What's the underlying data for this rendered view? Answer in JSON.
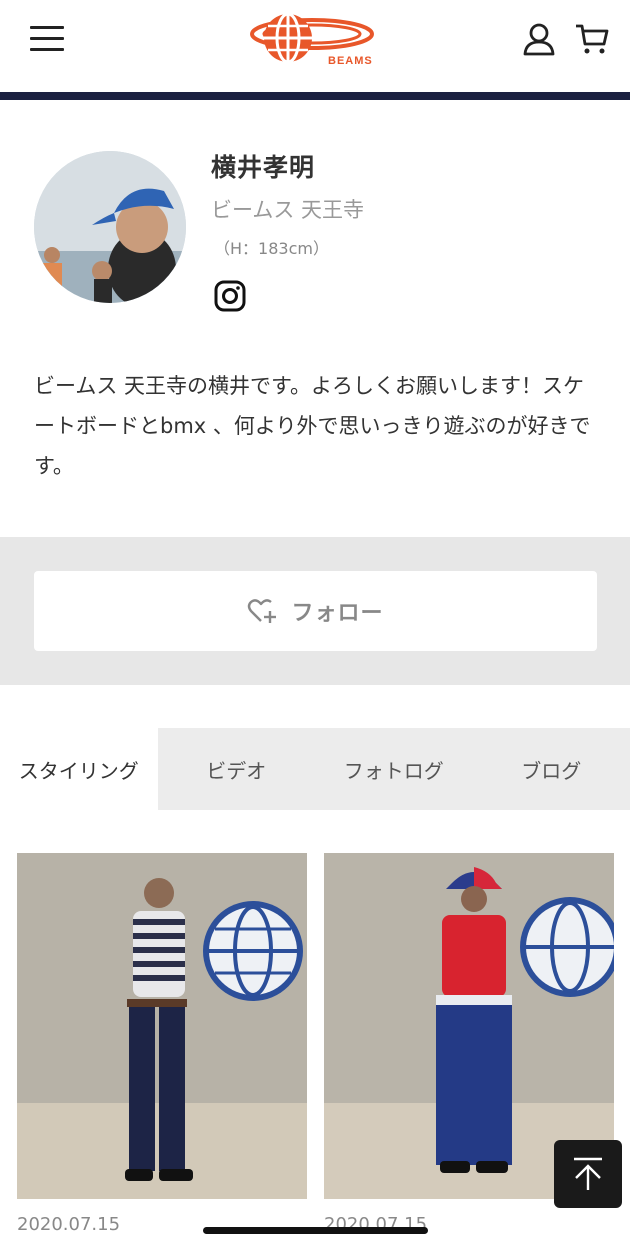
{
  "header": {
    "logo_text": "BEAMS",
    "menu_icon": "hamburger-icon",
    "user_icon": "user-icon",
    "cart_icon": "cart-icon",
    "accent_color": "#e8572a",
    "bar_color": "#1b2141"
  },
  "profile": {
    "name": "横井孝明",
    "shop": "ビームス 天王寺",
    "height": "（H：183cm）",
    "social_icon": "instagram-icon",
    "bio": "ビームス 天王寺の横井です。よろしくお願いします！スケートボードとbmx 、何より外で思いっきり遊ぶのが好きです。"
  },
  "follow": {
    "label": "フォロー",
    "icon": "heart-plus-icon"
  },
  "tabs": [
    {
      "label": "スタイリング",
      "active": true
    },
    {
      "label": "ビデオ",
      "active": false
    },
    {
      "label": "フォトログ",
      "active": false
    },
    {
      "label": "ブログ",
      "active": false
    }
  ],
  "stylings": [
    {
      "date": "2020.07.15"
    },
    {
      "date": "2020.07.15"
    }
  ],
  "scroll_top_icon": "arrow-up-icon"
}
